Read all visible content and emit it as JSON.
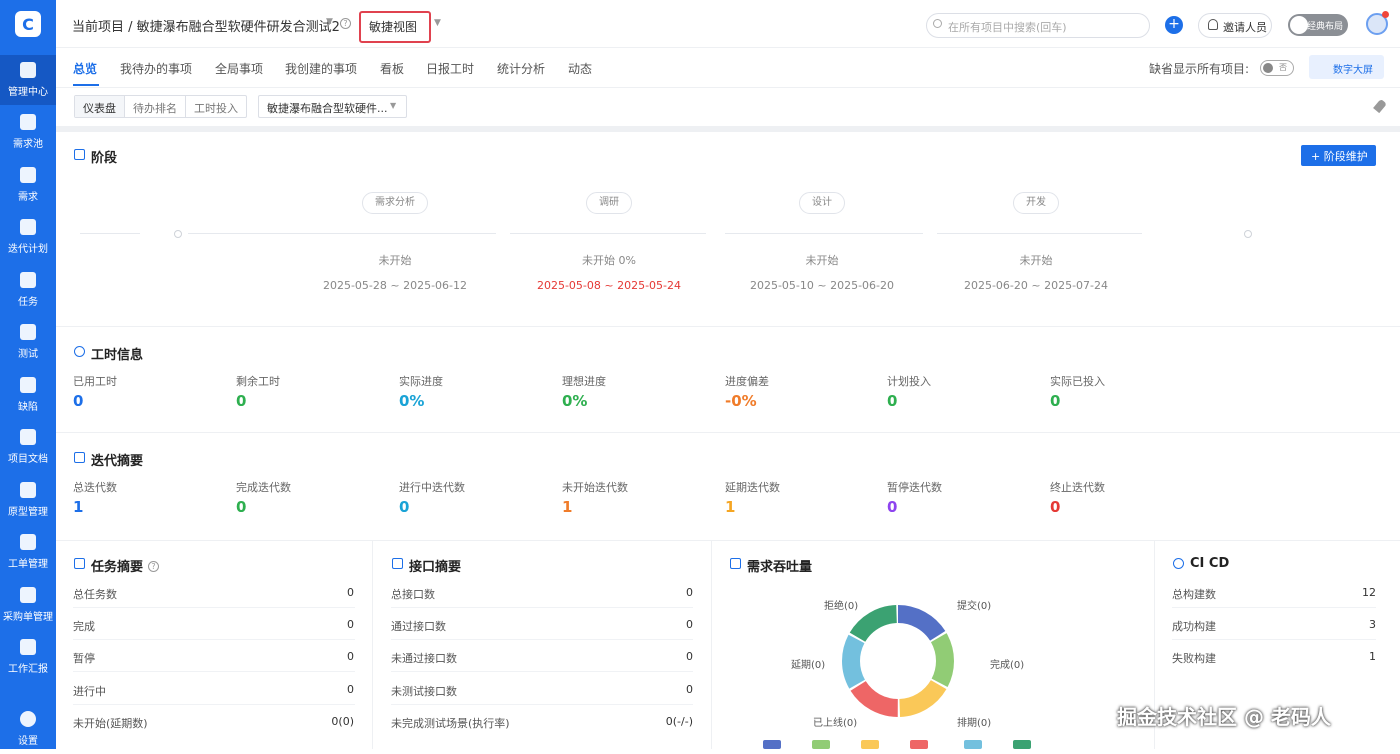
{
  "app": {
    "logo": "C"
  },
  "sidebar": {
    "items": [
      {
        "label": "管理中心",
        "icon": "chat-icon"
      },
      {
        "label": "需求池",
        "icon": "document-icon"
      },
      {
        "label": "需求",
        "icon": "document-icon"
      },
      {
        "label": "迭代计划",
        "icon": "layers-icon"
      },
      {
        "label": "任务",
        "icon": "clipboard-icon"
      },
      {
        "label": "测试",
        "icon": "flask-icon"
      },
      {
        "label": "缺陷",
        "icon": "bug-icon"
      },
      {
        "label": "项目文档",
        "icon": "book-icon"
      },
      {
        "label": "原型管理",
        "icon": "tools-icon"
      },
      {
        "label": "工单管理",
        "icon": "ticket-icon"
      },
      {
        "label": "采购单管理",
        "icon": "cart-icon"
      },
      {
        "label": "工作汇报",
        "icon": "mail-icon"
      },
      {
        "label": "设置",
        "icon": "gear-icon"
      }
    ]
  },
  "header": {
    "breadcrumb": "当前项目 / 敏捷瀑布融合型软硬件研发合测试2",
    "help": "?",
    "view_select": "敏捷视图",
    "search_placeholder": "在所有项目中搜索(回车)",
    "add_label": "+",
    "invite_label": "邀请人员",
    "layout_toggle_label": "经典布局"
  },
  "tabs": {
    "items": [
      "总览",
      "我待办的事项",
      "全局事项",
      "我创建的事项",
      "看板",
      "日报工时",
      "统计分析",
      "动态"
    ],
    "show_all_label": "缺省显示所有项目:",
    "show_all_toggle": "否",
    "screen_button": "数字大屏"
  },
  "subbar": {
    "segments": [
      "仪表盘",
      "待办排名",
      "工时投入"
    ],
    "project_select": "敏捷瀑布融合型软硬件..."
  },
  "stages": {
    "title": "阶段",
    "button": "+ 阶段维护",
    "items": [
      {
        "name": "需求分析",
        "status": "未开始",
        "dates": "2025-05-28 ~ 2025-06-12"
      },
      {
        "name": "调研",
        "status": "未开始 0%",
        "dates": "2025-05-08 ~ 2025-05-24"
      },
      {
        "name": "设计",
        "status": "未开始",
        "dates": "2025-05-10 ~ 2025-06-20"
      },
      {
        "name": "开发",
        "status": "未开始",
        "dates": "2025-06-20 ~ 2025-07-24"
      }
    ]
  },
  "worktime": {
    "title": "工时信息",
    "metrics": [
      {
        "label": "已用工时",
        "value": "0",
        "color": "#1d6fe8"
      },
      {
        "label": "剩余工时",
        "value": "0",
        "color": "#2eaf4f"
      },
      {
        "label": "实际进度",
        "value": "0%",
        "color": "#1aa3d6"
      },
      {
        "label": "理想进度",
        "value": "0%",
        "color": "#2eaf4f"
      },
      {
        "label": "进度偏差",
        "value": "-0%",
        "color": "#f07c2a"
      },
      {
        "label": "计划投入",
        "value": "0",
        "color": "#2eaf4f"
      },
      {
        "label": "实际已投入",
        "value": "0",
        "color": "#2eaf4f"
      }
    ]
  },
  "iteration": {
    "title": "迭代摘要",
    "metrics": [
      {
        "label": "总迭代数",
        "value": "1",
        "color": "#1d6fe8"
      },
      {
        "label": "完成迭代数",
        "value": "0",
        "color": "#2eaf4f"
      },
      {
        "label": "进行中迭代数",
        "value": "0",
        "color": "#1aa3d6"
      },
      {
        "label": "未开始迭代数",
        "value": "1",
        "color": "#f07c2a"
      },
      {
        "label": "延期迭代数",
        "value": "1",
        "color": "#f5a623"
      },
      {
        "label": "暂停迭代数",
        "value": "0",
        "color": "#8e44ef"
      },
      {
        "label": "终止迭代数",
        "value": "0",
        "color": "#e53935"
      }
    ]
  },
  "task_summary": {
    "title": "任务摘要",
    "rows": [
      {
        "label": "总任务数",
        "value": "0"
      },
      {
        "label": "完成",
        "value": "0"
      },
      {
        "label": "暂停",
        "value": "0"
      },
      {
        "label": "进行中",
        "value": "0"
      },
      {
        "label": "未开始(延期数)",
        "value": "0(0)"
      }
    ]
  },
  "api_summary": {
    "title": "接口摘要",
    "rows": [
      {
        "label": "总接口数",
        "value": "0"
      },
      {
        "label": "通过接口数",
        "value": "0"
      },
      {
        "label": "未通过接口数",
        "value": "0"
      },
      {
        "label": "未测试接口数",
        "value": "0"
      },
      {
        "label": "未完成测试场景(执行率)",
        "value": "0(-/-)"
      }
    ]
  },
  "throughput": {
    "title": "需求吞吐量",
    "segments": [
      {
        "label": "提交(0)",
        "value": 0,
        "color": "#5470c6"
      },
      {
        "label": "完成(0)",
        "value": 0,
        "color": "#91cc75"
      },
      {
        "label": "排期(0)",
        "value": 0,
        "color": "#fac858"
      },
      {
        "label": "已上线(0)",
        "value": 0,
        "color": "#ee6666"
      },
      {
        "label": "延期(0)",
        "value": 0,
        "color": "#73c0de"
      },
      {
        "label": "拒绝(0)",
        "value": 0,
        "color": "#3ba272"
      }
    ]
  },
  "cicd": {
    "title": "CI CD",
    "rows": [
      {
        "label": "总构建数",
        "value": "12"
      },
      {
        "label": "成功构建",
        "value": "3"
      },
      {
        "label": "失败构建",
        "value": "1"
      }
    ]
  },
  "watermark": "掘金技术社区 @ 老码人"
}
